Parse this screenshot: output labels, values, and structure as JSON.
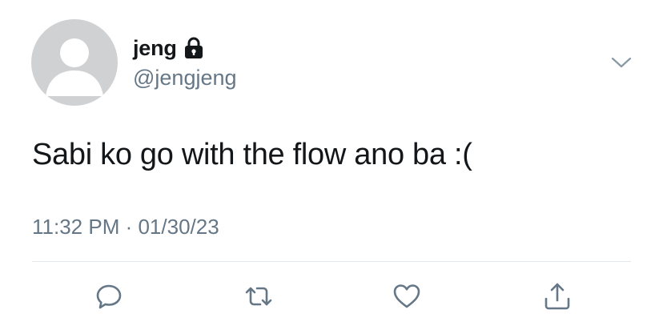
{
  "user": {
    "display_name": "jeng",
    "handle": "@jengjeng",
    "avatar_icon": "default-avatar-icon",
    "protected_icon": "lock-icon"
  },
  "tweet": {
    "text": "Sabi ko go with the flow ano ba :(",
    "time": "11:32 PM",
    "separator": " · ",
    "date": "01/30/23"
  },
  "actions": [
    {
      "icon": "reply-icon"
    },
    {
      "icon": "retweet-icon"
    },
    {
      "icon": "like-icon"
    },
    {
      "icon": "share-icon"
    }
  ],
  "menu": {
    "icon": "chevron-down-icon"
  },
  "colors": {
    "text": "#14171a",
    "secondary": "#657786",
    "icon": "#657786",
    "divider": "#e1e8ed",
    "avatar_bg": "#cfd1d3"
  }
}
